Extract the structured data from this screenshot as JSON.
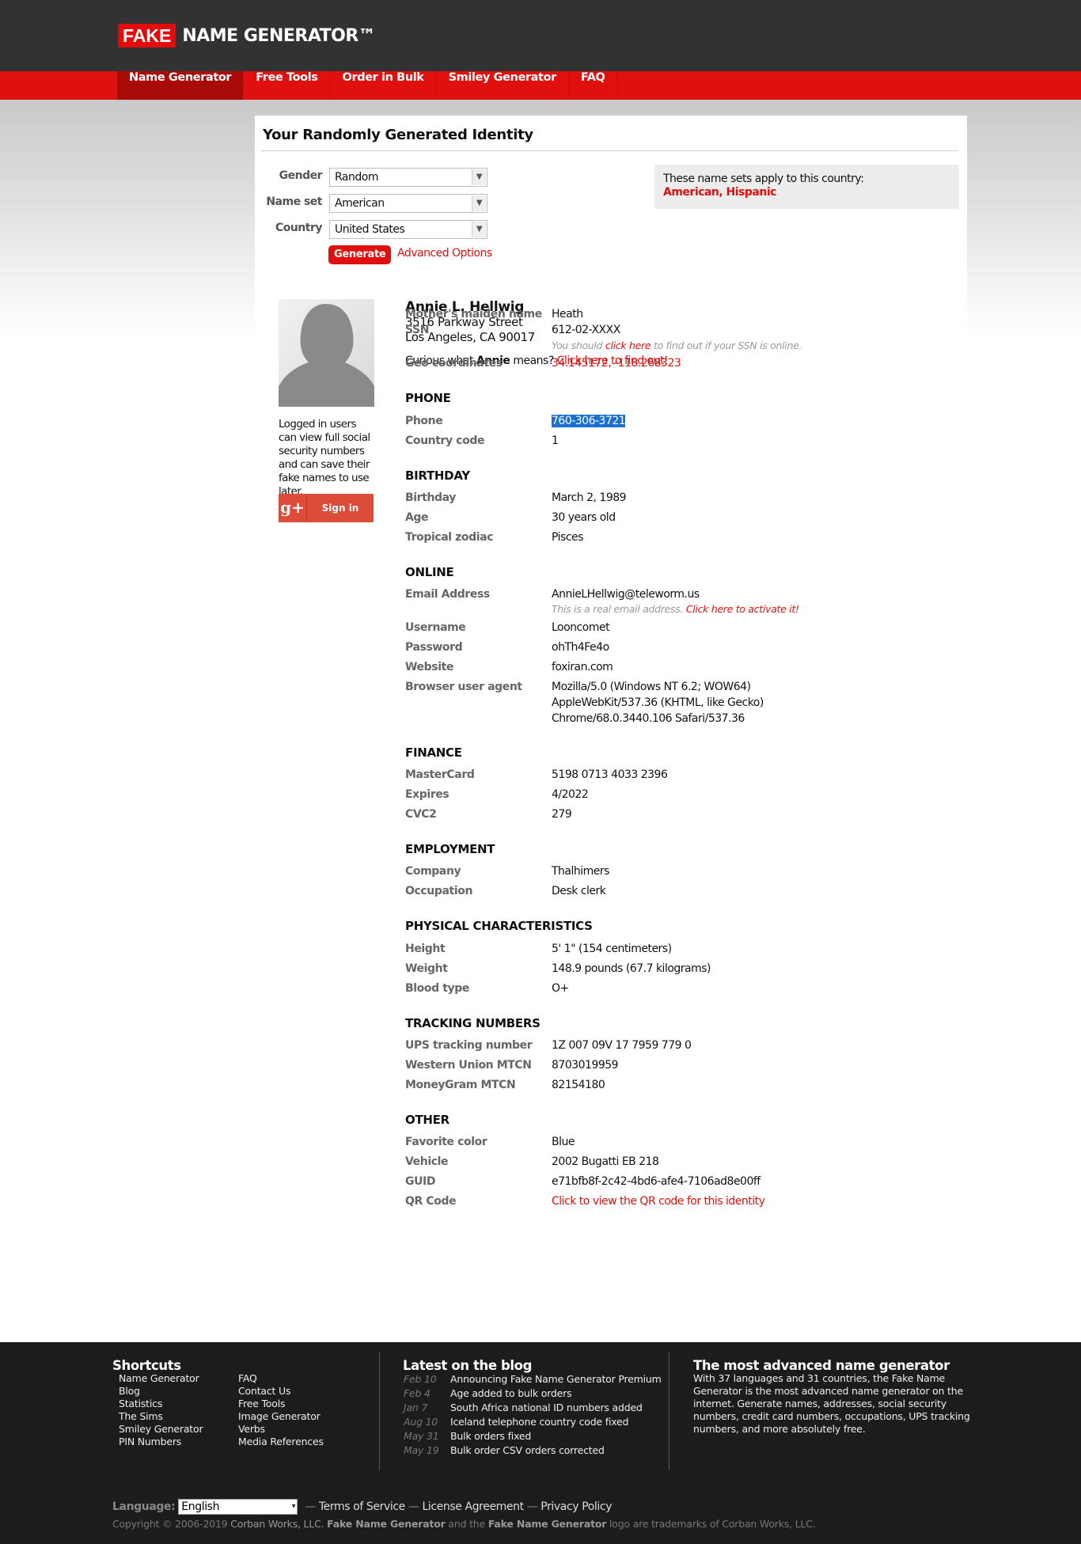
{
  "header": {
    "logo_fake": "FAKE",
    "logo_rest": "NAME GENERATOR™"
  },
  "nav": [
    "Name Generator",
    "Free Tools",
    "Order in Bulk",
    "Smiley Generator",
    "FAQ"
  ],
  "page_title": "Your Randomly Generated Identity",
  "form": {
    "gender_label": "Gender",
    "gender_value": "Random",
    "nameset_label": "Name set",
    "nameset_value": "American",
    "country_label": "Country",
    "country_value": "United States",
    "generate": "Generate",
    "advanced": "Advanced Options"
  },
  "namesets": {
    "text": "These name sets apply to this country:",
    "american": "American",
    "comma": ",",
    "hispanic": "Hispanic"
  },
  "sidebar": {
    "logged_text": "Logged in users can view full social security numbers and can save their fake names to use later.",
    "signin": "Sign in",
    "gplus": "g+"
  },
  "identity": {
    "name": "Annie L. Hellwig",
    "street": "3516 Parkway Street",
    "city": "Los Angeles, CA 90017",
    "curious_pre": "Curious what ",
    "curious_name": "Annie",
    "curious_post": " means? ",
    "curious_link": "Click here to find out!"
  },
  "fields": {
    "maiden_l": "Mother's maiden name",
    "maiden_v": "Heath",
    "ssn_l": "SSN",
    "ssn_v": "612-02-XXXX",
    "ssn_note_pre": "You should ",
    "ssn_note_link": "click here",
    "ssn_note_post": " to find out if your SSN is online.",
    "geo_l": "Geo coordinates",
    "geo_v": "34.145172, -118.268323",
    "phone_h": "PHONE",
    "phone_l": "Phone",
    "phone_v": "760-306-3721",
    "cc_l": "Country code",
    "cc_v": "1",
    "birthday_h": "BIRTHDAY",
    "bday_l": "Birthday",
    "bday_v": "March 2, 1989",
    "age_l": "Age",
    "age_v": "30 years old",
    "zodiac_l": "Tropical zodiac",
    "zodiac_v": "Pisces",
    "online_h": "ONLINE",
    "email_l": "Email Address",
    "email_v": "AnnieLHellwig@teleworm.us",
    "email_note_pre": "This is a real email address. ",
    "email_note_link": "Click here to activate it!",
    "user_l": "Username",
    "user_v": "Looncomet",
    "pass_l": "Password",
    "pass_v": "ohTh4Fe4o",
    "web_l": "Website",
    "web_v": "foxiran.com",
    "ua_l": "Browser user agent",
    "ua_1": "Mozilla/5.0 (Windows NT 6.2; WOW64)",
    "ua_2": "AppleWebKit/537.36 (KHTML, like Gecko)",
    "ua_3": "Chrome/68.0.3440.106 Safari/537.36",
    "finance_h": "FINANCE",
    "mc_l": "MasterCard",
    "mc_v": "5198 0713 4033 2396",
    "exp_l": "Expires",
    "exp_v": "4/2022",
    "cvc_l": "CVC2",
    "cvc_v": "279",
    "employment_h": "EMPLOYMENT",
    "company_l": "Company",
    "company_v": "Thalhimers",
    "occ_l": "Occupation",
    "occ_v": "Desk clerk",
    "physical_h": "PHYSICAL CHARACTERISTICS",
    "height_l": "Height",
    "height_v": "5' 1\" (154 centimeters)",
    "weight_l": "Weight",
    "weight_v": "148.9 pounds (67.7 kilograms)",
    "blood_l": "Blood type",
    "blood_v": "O+",
    "tracking_h": "TRACKING NUMBERS",
    "ups_l": "UPS tracking number",
    "ups_v": "1Z 007 09V 17 7959 779 0",
    "wu_l": "Western Union MTCN",
    "wu_v": "8703019959",
    "mg_l": "MoneyGram MTCN",
    "mg_v": "82154180",
    "other_h": "OTHER",
    "color_l": "Favorite color",
    "color_v": "Blue",
    "vehicle_l": "Vehicle",
    "vehicle_v": "2002 Bugatti EB 218",
    "guid_l": "GUID",
    "guid_v": "e71bfb8f-2c42-4bd6-afe4-7106ad8e00ff",
    "qr_l": "QR Code",
    "qr_v": "Click to view the QR code for this identity"
  },
  "footer": {
    "shortcuts_h": "Shortcuts",
    "col1": [
      "Name Generator",
      "Blog",
      "Statistics",
      "The Sims",
      "Smiley Generator",
      "PIN Numbers"
    ],
    "col2": [
      "FAQ",
      "Contact Us",
      "Free Tools",
      "Image Generator",
      "Verbs",
      "Media References"
    ],
    "blog_h": "Latest on the blog",
    "blog": [
      {
        "d": "Feb 10",
        "t": "Announcing Fake Name Generator Premium"
      },
      {
        "d": "Feb 4",
        "t": "Age added to bulk orders"
      },
      {
        "d": "Jan 7",
        "t": "South Africa national ID numbers added"
      },
      {
        "d": "Aug 10",
        "t": "Iceland telephone country code fixed"
      },
      {
        "d": "May 31",
        "t": "Bulk orders fixed"
      },
      {
        "d": "May 19",
        "t": "Bulk order CSV orders corrected"
      }
    ],
    "adv_h": "The most advanced name generator",
    "adv_text": "With 37 languages and 31 countries, the Fake Name Generator is the most advanced name generator on the internet. Generate names, addresses, social security numbers, credit card numbers, occupations, UPS tracking numbers, and more absolutely free.",
    "lang_label": "Language:",
    "lang_value": "English",
    "tos": "Terms of Service",
    "license": "License Agreement",
    "privacy": "Privacy Policy",
    "dash": "—",
    "copy_1": "Copyright © 2006-2019 ",
    "copy_2": "Corban Works, LLC.",
    "copy_3": "Fake Name Generator",
    "copy_4": " and the ",
    "copy_5": "Fake Name Generator",
    "copy_6": " logo are trademarks of Corban Works, LLC."
  },
  "colors": {
    "accent": "#e0100f",
    "header_bg": "#323232",
    "footer_bg": "#1c1c1c"
  }
}
